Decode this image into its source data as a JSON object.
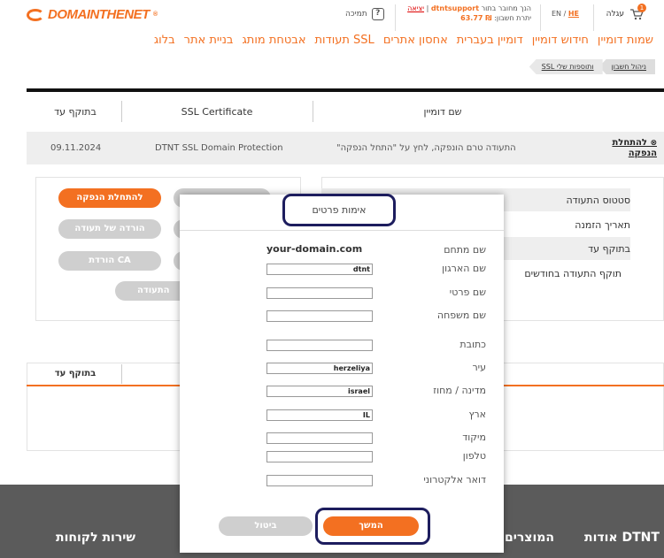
{
  "header": {
    "logo": "DOMAINTHENET",
    "cart_label": "עגלה",
    "cart_count": "1",
    "lang_en": "EN",
    "lang_he": "HE",
    "user_connected": "הנך מחובר בתור",
    "username": "dtntsupport",
    "logout": "יציאה",
    "balance_label": "יתרת חשבון:",
    "balance_value": "₪ 63.77",
    "support": "תמיכה"
  },
  "nav": [
    "שמות דומיין",
    "חידוש דומיין",
    "דומיין בעברית",
    "אחסון אתרים",
    "תעודות SSL",
    "אבטחת מותג",
    "בניית אתר",
    "בלוג"
  ],
  "breadcrumb": [
    "ניהול חשבון",
    "SSL ותוספות שלי"
  ],
  "table": {
    "headers": [
      "שם דומיין",
      "SSL Certificate",
      "בתוקף עד"
    ],
    "row": {
      "action": "להתחלת הנפקה",
      "status": "התעודה טרם הונפקה, לחץ על \"התחל הנפקה\"",
      "product": "DTNT SSL Domain Protection",
      "date": "09.11.2024"
    }
  },
  "details": {
    "labels": [
      "סטטוס התעודה",
      "תאריך הזמנה",
      "בתוקף עד",
      "תוקף התעודה בחודשים"
    ],
    "buttons": [
      "להתחלת הנפקה",
      "הורדה של תעודה",
      "הורדת CA",
      "התעודה"
    ]
  },
  "table2": {
    "header": "בתוקף עד"
  },
  "modal": {
    "title": "אימות פרטים",
    "domain_label": "שם מתחם",
    "domain_value": "your-domain.com",
    "fields": [
      {
        "label": "שם הארגון",
        "value": "dtnt"
      },
      {
        "label": "שם פרטי",
        "value": ""
      },
      {
        "label": "שם משפחה",
        "value": ""
      },
      {
        "label": "כתובת",
        "value": ""
      },
      {
        "label": "עיר",
        "value": "herzeliya"
      },
      {
        "label": "מדינה / מחוז",
        "value": "israel"
      },
      {
        "label": "ארץ",
        "value": "IL"
      },
      {
        "label": "מיקוד",
        "value": ""
      },
      {
        "label": "טלפון",
        "value": ""
      },
      {
        "label": "דואר אלקטרוני",
        "value": ""
      }
    ],
    "continue": "המשך",
    "cancel": "ביטול"
  },
  "footer": {
    "about": "אודות DTNT",
    "products": "המוצרים",
    "service": "שירות לקוחות"
  },
  "colors": {
    "accent": "#f37021",
    "highlight_border": "#1d1d5e"
  }
}
